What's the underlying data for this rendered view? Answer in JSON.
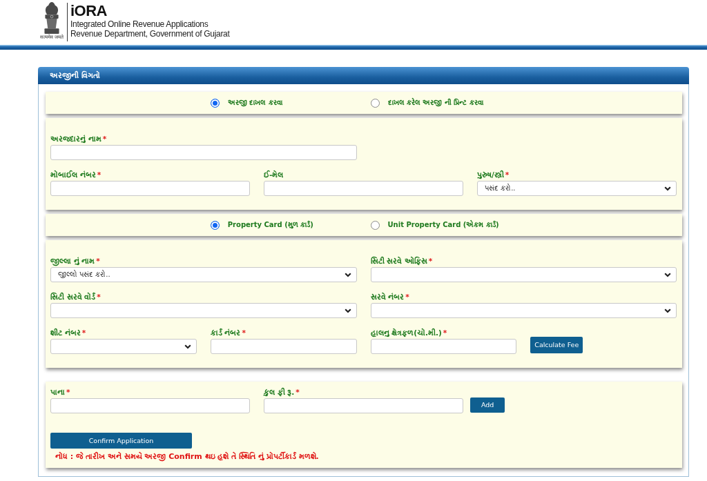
{
  "header": {
    "motto": "सत्यमेव जयते",
    "app_name": "iORA",
    "app_full_name": "Integrated Online Revenue Applications",
    "department": "Revenue Department, Government of Gujarat"
  },
  "panel": {
    "title": "અરજીની વિગતો",
    "sections": [
      {
        "kind": "radio_row",
        "options": [
          {
            "label": "અરજી દાખલ કરવા",
            "selected": true
          },
          {
            "label": "દાખલ કરેલ અરજી ની પ્રિન્ટ કરવા",
            "selected": false
          }
        ]
      },
      {
        "kind": "fields",
        "rows": [
          [
            {
              "kind": "text",
              "label": "અરજદારનું નામ",
              "required_mark": "*"
            }
          ],
          [
            {
              "kind": "text",
              "label": "મોબાઈલ નંબર",
              "required_mark": "*"
            },
            {
              "kind": "text",
              "label": "ઈ-મેલ"
            },
            {
              "kind": "select",
              "label": "પુરુષ/સ્ત્રી",
              "required_mark": "*",
              "value": "પસંદ કરો.."
            }
          ]
        ]
      },
      {
        "kind": "radio_row",
        "options": [
          {
            "label": "Property Card (મુળ કાર્ડ)",
            "selected": true
          },
          {
            "label": "Unit Property Card (એકમ કાર્ડ)",
            "selected": false
          }
        ]
      },
      {
        "kind": "fields",
        "rows": [
          [
            {
              "kind": "select",
              "label": "જીલ્લા નું નામ",
              "required_mark": "*",
              "value": "જીલ્લો પસંદ કરો.."
            },
            {
              "kind": "select",
              "label": "સિટી સરવે ઓફિસ",
              "required_mark": "*"
            }
          ],
          [
            {
              "kind": "select",
              "label": "સિટી સરવે વોર્ડ",
              "required_mark": "*"
            },
            {
              "kind": "select",
              "label": "સરવે નંબર",
              "required_mark": "*"
            }
          ],
          [
            {
              "kind": "select",
              "label": "શીટ નંબર",
              "required_mark": "*"
            },
            {
              "kind": "text",
              "label": "કાર્ડ નંબર",
              "required_mark": "*"
            },
            {
              "kind": "text",
              "label": "હાલનુ ક્ષેત્રફળ(ચો.મી.)",
              "required_mark": "*"
            },
            {
              "kind": "button",
              "label": "Calculate Fee"
            }
          ]
        ]
      },
      {
        "kind": "fields",
        "rows": [
          [
            {
              "kind": "text",
              "label": "પાના",
              "required_mark": "*"
            },
            {
              "kind": "text",
              "label": "કુલ ફી રૂ.",
              "required_mark": "*"
            },
            {
              "kind": "button",
              "label": "Add"
            }
          ]
        ],
        "submit_button": "Confirm Application",
        "note": "નોધ : જે તારીખ અને સમયે અરજી Confirm થઇ હશે તે સ્થિતિ નું પ્રોપર્ટીકાર્ડ મળશે."
      }
    ]
  }
}
